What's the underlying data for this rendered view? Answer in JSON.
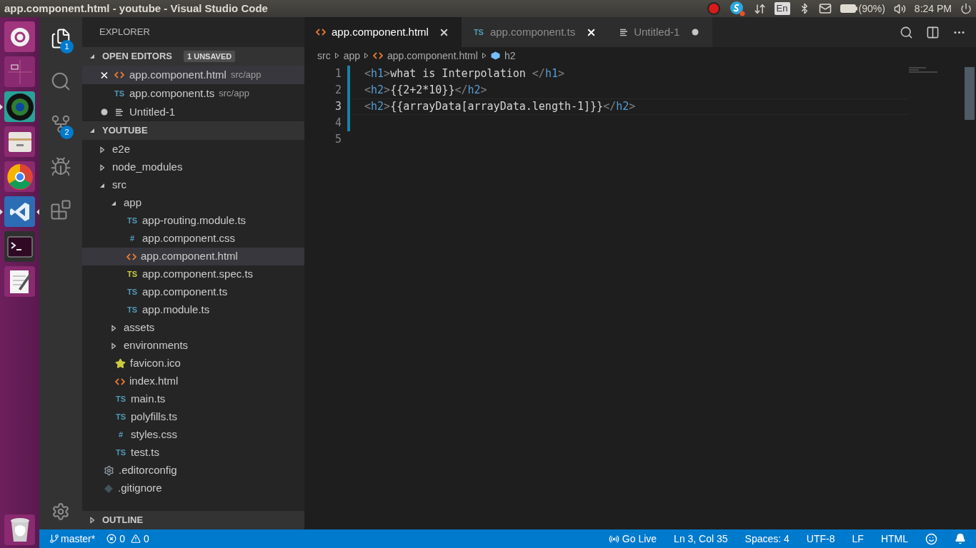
{
  "top_bar": {
    "title": "app.component.html - youtube - Visual Studio Code",
    "keyboard": "En",
    "battery": "(90%)",
    "clock": "8:24 PM"
  },
  "launcher": [
    {
      "kind": "home",
      "running": false
    },
    {
      "kind": "workspaces",
      "running": false
    },
    {
      "kind": "camera",
      "running": true
    },
    {
      "kind": "files",
      "running": false
    },
    {
      "kind": "browser",
      "running": false
    },
    {
      "kind": "code",
      "running": true
    },
    {
      "kind": "terminal",
      "running": false
    },
    {
      "kind": "notepad",
      "running": false
    },
    {
      "kind": "trash",
      "running": false
    }
  ],
  "activity_bar": [
    {
      "kind": "explorer",
      "selected": true,
      "badge": "1"
    },
    {
      "kind": "search",
      "selected": false
    },
    {
      "kind": "source-control",
      "selected": false,
      "badge": "2"
    },
    {
      "kind": "debug",
      "selected": false
    },
    {
      "kind": "extensions",
      "selected": false
    }
  ],
  "sidebar": {
    "title": "EXPLORER",
    "open_editors": {
      "title": "OPEN EDITORS",
      "badge": "1 UNSAVED",
      "expanded": true,
      "items": [
        {
          "name": "app.component.html",
          "path": "src/app",
          "kind": "html",
          "selected": true,
          "dirty": false
        },
        {
          "name": "app.component.ts",
          "path": "src/app",
          "kind": "ts",
          "icon_label": "TS",
          "selected": false,
          "dirty": false
        },
        {
          "name": "Untitled-1",
          "kind": "text",
          "selected": false,
          "dirty": true
        }
      ]
    },
    "project": {
      "title": "YOUTUBE",
      "expanded": true,
      "children": [
        {
          "name": "e2e",
          "kind": "folder",
          "expanded": false,
          "selected": false
        },
        {
          "name": "node_modules",
          "kind": "folder",
          "expanded": false,
          "selected": false
        },
        {
          "name": "src",
          "kind": "folder",
          "expanded": true,
          "selected": false,
          "children": [
            {
              "name": "app",
              "kind": "folder",
              "expanded": true,
              "selected": false,
              "children": [
                {
                  "name": "app-routing.module.ts",
                  "kind": "ts",
                  "icon_label": "TS",
                  "selected": false
                },
                {
                  "name": "app.component.css",
                  "kind": "css",
                  "icon_label": "#",
                  "selected": false
                },
                {
                  "name": "app.component.html",
                  "kind": "html",
                  "selected": true
                },
                {
                  "name": "app.component.spec.ts",
                  "kind": "spec",
                  "icon_label": "TS",
                  "selected": false
                },
                {
                  "name": "app.component.ts",
                  "kind": "ts",
                  "icon_label": "TS",
                  "selected": false
                },
                {
                  "name": "app.module.ts",
                  "kind": "ts",
                  "icon_label": "TS",
                  "selected": false
                }
              ]
            },
            {
              "name": "assets",
              "kind": "folder",
              "expanded": false,
              "selected": false
            },
            {
              "name": "environments",
              "kind": "folder",
              "expanded": false,
              "selected": false
            },
            {
              "name": "favicon.ico",
              "kind": "star",
              "selected": false
            },
            {
              "name": "index.html",
              "kind": "html",
              "selected": false
            },
            {
              "name": "main.ts",
              "kind": "ts",
              "icon_label": "TS",
              "selected": false
            },
            {
              "name": "polyfills.ts",
              "kind": "ts",
              "icon_label": "TS",
              "selected": false
            },
            {
              "name": "styles.css",
              "kind": "css",
              "icon_label": "#",
              "selected": false
            },
            {
              "name": "test.ts",
              "kind": "ts",
              "icon_label": "TS",
              "selected": false
            }
          ]
        },
        {
          "name": ".editorconfig",
          "kind": "config",
          "selected": false
        },
        {
          "name": ".gitignore",
          "kind": "git",
          "selected": false
        }
      ]
    },
    "outline": {
      "title": "OUTLINE",
      "expanded": false
    }
  },
  "tabs": [
    {
      "label": "app.component.html",
      "kind": "html",
      "selected": true,
      "hovered": false,
      "dirty": false
    },
    {
      "label": "app.component.ts",
      "kind": "ts",
      "icon_label": "TS",
      "selected": false,
      "hovered": true,
      "dirty": false
    },
    {
      "label": "Untitled-1",
      "kind": "text",
      "selected": false,
      "hovered": false,
      "dirty": true
    }
  ],
  "breadcrumbs": [
    {
      "label": "src",
      "kind": "folder"
    },
    {
      "label": "app",
      "kind": "folder"
    },
    {
      "label": "app.component.html",
      "kind": "html"
    },
    {
      "label": "h2",
      "kind": "element"
    }
  ],
  "editor": {
    "lines": [
      {
        "number": "1",
        "text": "<h1>what is Interpolation </h1>",
        "changed": true,
        "selected": false
      },
      {
        "number": "2",
        "text": "<h2>{{2+2*10}}</h2>",
        "changed": true,
        "selected": false
      },
      {
        "number": "3",
        "text": "<h2>{{arrayData[arrayData.length-1]}}</h2>",
        "changed": true,
        "selected": true
      },
      {
        "number": "4",
        "changed": true,
        "selected": false
      },
      {
        "number": "5",
        "changed": false,
        "selected": false
      }
    ]
  },
  "status_bar": {
    "branch": "master*",
    "errors": "0",
    "warnings": "0",
    "items": [
      {
        "label": "Go Live",
        "kind": "live"
      },
      {
        "label": "Ln 3, Col 35"
      },
      {
        "label": "Spaces: 4"
      },
      {
        "label": "UTF-8"
      },
      {
        "label": "LF"
      },
      {
        "label": "HTML"
      }
    ]
  }
}
